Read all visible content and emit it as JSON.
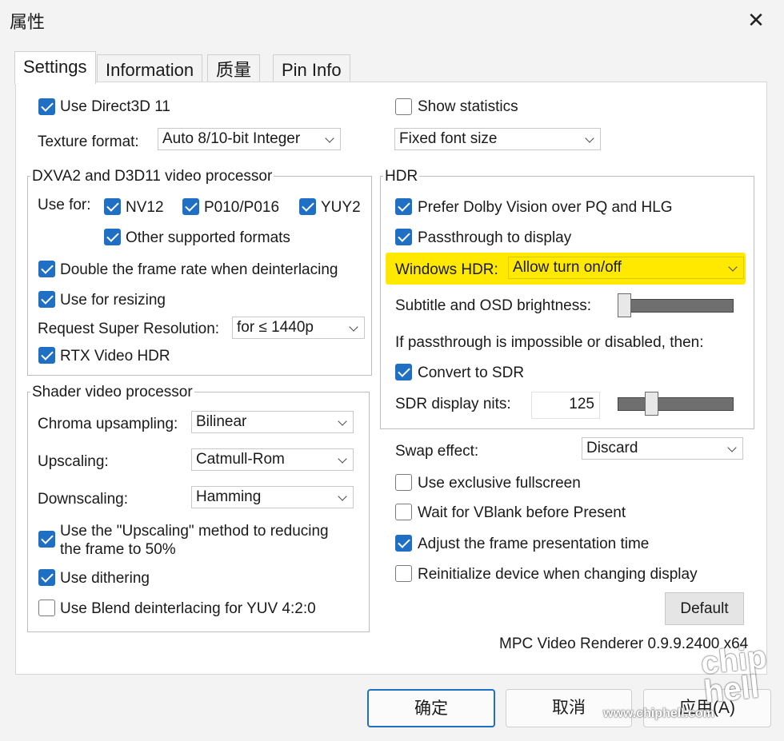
{
  "window": {
    "title": "属性",
    "close_icon": "close-icon"
  },
  "tabs": [
    "Settings",
    "Information",
    "质量",
    "Pin Info"
  ],
  "settings": {
    "use_d3d11": {
      "label": "Use Direct3D 11",
      "checked": true
    },
    "texture_format": {
      "label": "Texture format:",
      "value": "Auto 8/10-bit Integer"
    },
    "show_statistics": {
      "label": "Show statistics",
      "checked": false
    },
    "font_size": {
      "value": "Fixed font size"
    },
    "dxva_group": {
      "title": "DXVA2 and D3D11 video processor",
      "use_for_label": "Use for:",
      "nv12": "NV12",
      "p010": "P010/P016",
      "yuy2": "YUY2",
      "other_formats": "Other supported formats",
      "double_frame_rate": "Double the frame rate when deinterlacing",
      "use_for_resizing": "Use for resizing",
      "super_res_label": "Request Super Resolution:",
      "super_res_value": "for ≤ 1440p",
      "rtx_hdr": "RTX Video HDR"
    },
    "shader_group": {
      "title": "Shader video processor",
      "chroma_label": "Chroma upsampling:",
      "chroma_value": "Bilinear",
      "upscaling_label": "Upscaling:",
      "upscaling_value": "Catmull-Rom",
      "downscaling_label": "Downscaling:",
      "downscaling_value": "Hamming",
      "use_upscaling_line1": "Use the \"Upscaling\" method to reducing",
      "use_upscaling_line2": "the frame to 50%",
      "use_dithering": "Use dithering",
      "blend_deinterlacing": "Use Blend deinterlacing for YUV 4:2:0"
    },
    "hdr_group": {
      "title": "HDR",
      "prefer_dolby": "Prefer Dolby Vision over PQ and HLG",
      "passthrough": "Passthrough to display",
      "windows_hdr_label": "Windows HDR:",
      "windows_hdr_value": "Allow turn on/off",
      "subtitle_brightness_label": "Subtitle and OSD brightness:",
      "subtitle_brightness_level": 0,
      "if_passthrough_text": "If passthrough is impossible or disabled, then:",
      "convert_to_sdr": "Convert to SDR",
      "sdr_nits_label": "SDR display nits:",
      "sdr_nits_value": "125"
    },
    "swap_effect_label": "Swap effect:",
    "swap_effect_value": "Discard",
    "exclusive_fullscreen": "Use exclusive fullscreen",
    "wait_vblank": "Wait for VBlank before Present",
    "adjust_frame_time": "Adjust the frame presentation time",
    "reinit_device": "Reinitialize device when changing display",
    "default_button": "Default",
    "version": "MPC Video Renderer 0.9.9.2400 x64"
  },
  "buttons": {
    "ok": "确定",
    "cancel": "取消",
    "apply": "应用(A)"
  },
  "watermark": {
    "site": "www.chiphell.com"
  },
  "colors": {
    "accent": "#1f6fc5",
    "highlight": "#ffe900"
  }
}
